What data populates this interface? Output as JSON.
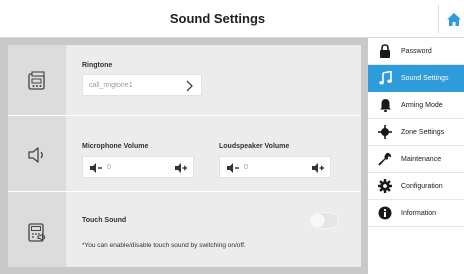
{
  "header": {
    "title": "Sound Settings",
    "home_icon": "home-icon"
  },
  "ringtone": {
    "label": "Ringtone",
    "value": "call_ringtone1",
    "icon": "ringtone-icon"
  },
  "volume": {
    "icon": "speaker-icon",
    "microphone": {
      "label": "Microphone Volume",
      "value": "0"
    },
    "loudspeaker": {
      "label": "Loudspeaker Volume",
      "value": "0"
    }
  },
  "touch_sound": {
    "icon": "touch-sound-icon",
    "label": "Touch Sound",
    "enabled": false,
    "hint": "*You can enable/disable touch sound by switching on/off."
  },
  "sidebar": {
    "items": [
      {
        "label": "Password",
        "icon": "lock-icon",
        "active": false
      },
      {
        "label": "Sound Settings",
        "icon": "music-note-icon",
        "active": true
      },
      {
        "label": "Arming Mode",
        "icon": "bell-icon",
        "active": false
      },
      {
        "label": "Zone Settings",
        "icon": "zone-icon",
        "active": false
      },
      {
        "label": "Maintenance",
        "icon": "wrench-icon",
        "active": false
      },
      {
        "label": "Configuration",
        "icon": "gear-icon",
        "active": false
      },
      {
        "label": "Information",
        "icon": "info-icon",
        "active": false
      }
    ]
  },
  "colors": {
    "accent": "#2e9bdb",
    "panel": "#ececec",
    "frame": "#c9c9c9"
  }
}
